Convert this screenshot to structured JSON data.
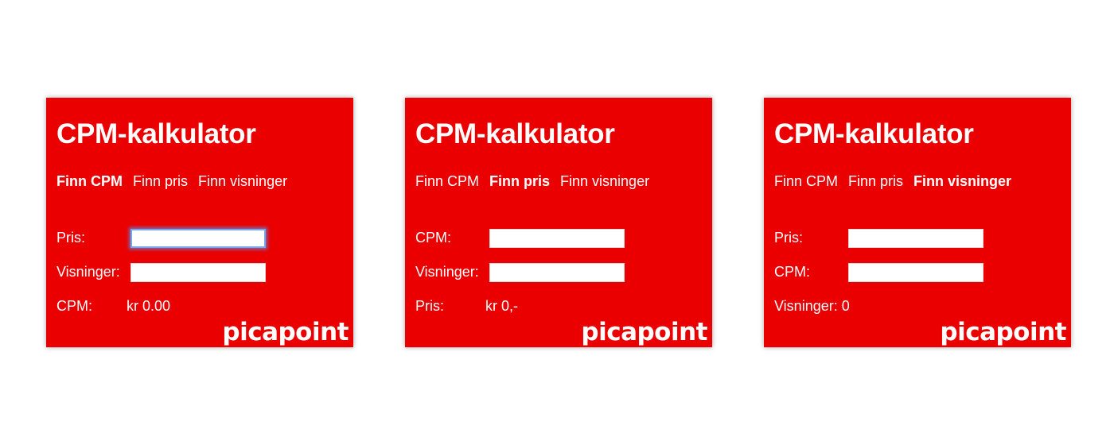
{
  "brand_color": "#ea0000",
  "logo": "picapoint",
  "cards": [
    {
      "title": "CPM-kalkulator",
      "tabs": [
        "Finn CPM",
        "Finn pris",
        "Finn visninger"
      ],
      "active_tab": 0,
      "field1_label": "Pris:",
      "field1_value": "",
      "field2_label": "Visninger:",
      "field2_value": "",
      "result_label": "CPM:",
      "result_value": "kr 0.00"
    },
    {
      "title": "CPM-kalkulator",
      "tabs": [
        "Finn CPM",
        "Finn pris",
        "Finn visninger"
      ],
      "active_tab": 1,
      "field1_label": "CPM:",
      "field1_value": "",
      "field2_label": "Visninger:",
      "field2_value": "",
      "result_label": "Pris:",
      "result_value": "kr 0,-"
    },
    {
      "title": "CPM-kalkulator",
      "tabs": [
        "Finn CPM",
        "Finn pris",
        "Finn visninger"
      ],
      "active_tab": 2,
      "field1_label": "Pris:",
      "field1_value": "",
      "field2_label": "CPM:",
      "field2_value": "",
      "result_label": "Visninger: 0",
      "result_value": ""
    }
  ]
}
